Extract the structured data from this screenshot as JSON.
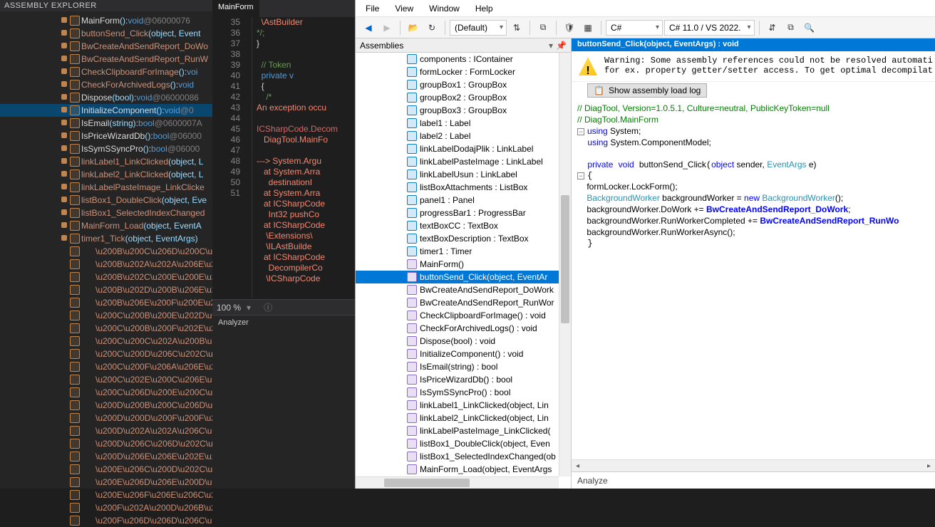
{
  "darkLeft": {
    "title": "Assembly Explorer",
    "items": [
      {
        "name": "MainForm",
        "params": "()",
        "type": "void",
        "addr": "@06000076",
        "sel": false,
        "orange": false
      },
      {
        "name": "buttonSend_Click",
        "params": "(object, Event",
        "type": "",
        "addr": "",
        "sel": false,
        "orange": true
      },
      {
        "name": "BwCreateAndSendReport_DoWo",
        "params": "",
        "type": "",
        "addr": "",
        "sel": false,
        "orange": true
      },
      {
        "name": "BwCreateAndSendReport_RunW",
        "params": "",
        "type": "",
        "addr": "",
        "sel": false,
        "orange": true
      },
      {
        "name": "CheckClipboardForImage",
        "params": "()",
        "type": "voi",
        "addr": "",
        "sel": false,
        "orange": true
      },
      {
        "name": "CheckForArchivedLogs",
        "params": "()",
        "type": "void",
        "addr": "",
        "sel": false,
        "orange": true
      },
      {
        "name": "Dispose",
        "params": "(bool)",
        "type": "void",
        "addr": "@06000086",
        "sel": false,
        "orange": false
      },
      {
        "name": "InitializeComponent",
        "params": "()",
        "type": "void",
        "addr": "@0",
        "sel": true,
        "orange": false
      },
      {
        "name": "IsEmail",
        "params": "(string)",
        "type": "bool",
        "addr": "@0600007A",
        "sel": false,
        "orange": false
      },
      {
        "name": "IsPriceWizardDb",
        "params": "()",
        "type": "bool",
        "addr": "@06000",
        "sel": false,
        "orange": false
      },
      {
        "name": "IsSymSSyncPro",
        "params": "()",
        "type": "bool",
        "addr": "@06000",
        "sel": false,
        "orange": false
      },
      {
        "name": "linkLabel1_LinkClicked",
        "params": "(object, L",
        "type": "",
        "addr": "",
        "sel": false,
        "orange": true
      },
      {
        "name": "linkLabel2_LinkClicked",
        "params": "(object, L",
        "type": "",
        "addr": "",
        "sel": false,
        "orange": true
      },
      {
        "name": "linkLabelPasteImage_LinkClicke",
        "params": "",
        "type": "",
        "addr": "",
        "sel": false,
        "orange": true
      },
      {
        "name": "listBox1_DoubleClick",
        "params": "(object, Eve",
        "type": "",
        "addr": "",
        "sel": false,
        "orange": true
      },
      {
        "name": "listBox1_SelectedIndexChanged",
        "params": "",
        "type": "",
        "addr": "",
        "sel": false,
        "orange": true
      },
      {
        "name": "MainForm_Load",
        "params": "(object, EventA",
        "type": "",
        "addr": "",
        "sel": false,
        "orange": true
      },
      {
        "name": "timer1_Tick",
        "params": "(object, EventArgs)",
        "type": "",
        "addr": "",
        "sel": false,
        "orange": true
      }
    ],
    "unicodeItems": [
      "\\u200B\\u200C\\u206D\\u200C\\u206E",
      "\\u200B\\u202A\\u202A\\u206E\\u2",
      "\\u200B\\u202C\\u200E\\u200E\\u20",
      "\\u200B\\u202D\\u200B\\u206E\\u2",
      "\\u200B\\u206E\\u200F\\u200E\\u20",
      "\\u200C\\u200B\\u200E\\u202D\\u2",
      "\\u200C\\u200B\\u200F\\u202E\\u2",
      "\\u200C\\u200C\\u202A\\u200B\\u2",
      "\\u200C\\u200D\\u206C\\u202C\\u2",
      "\\u200C\\u200F\\u206A\\u206E\\u2",
      "\\u200C\\u202E\\u200C\\u206E\\u2",
      "\\u200C\\u206D\\u200E\\u200C\\u2",
      "\\u200D\\u200B\\u200C\\u206D\\u2",
      "\\u200D\\u200D\\u200F\\u200F\\u2",
      "\\u200D\\u202A\\u202A\\u206C\\u2",
      "\\u200D\\u206C\\u206D\\u202C\\u2",
      "\\u200D\\u206E\\u206E\\u202E\\u2",
      "\\u200E\\u206C\\u200D\\u202C\\u2",
      "\\u200E\\u206D\\u206E\\u200D\\u2",
      "\\u200E\\u206F\\u206E\\u206C\\u2",
      "\\u200F\\u202A\\u200D\\u206B\\u2",
      "\\u200F\\u206D\\u206D\\u206C\\u2"
    ]
  },
  "darkMid": {
    "tab": "MainForm",
    "lines": [
      {
        "n": "",
        "t": "  \\AstBuilder",
        "cls": "er"
      },
      {
        "n": "35",
        "t": "*/;",
        "cls": "cm"
      },
      {
        "n": "36",
        "t": "}",
        "cls": ""
      },
      {
        "n": "37",
        "t": "",
        "cls": ""
      },
      {
        "n": "38",
        "t": "  // Token",
        "cls": "cm"
      },
      {
        "n": "39",
        "t": "  private v",
        "cls": "kw"
      },
      {
        "n": "40",
        "t": "  {",
        "cls": ""
      },
      {
        "n": "41",
        "t": "    /*",
        "cls": "cm"
      },
      {
        "n": "42",
        "t": "An exception occu",
        "cls": "er"
      },
      {
        "n": "43",
        "t": "",
        "cls": ""
      },
      {
        "n": "44",
        "t": "ICSharpCode.Decom",
        "cls": "er2"
      },
      {
        "n": "",
        "t": "   DiagTool.MainFo",
        "cls": "er"
      },
      {
        "n": "45",
        "t": "",
        "cls": ""
      },
      {
        "n": "46",
        "t": "---> System.Argu",
        "cls": "er"
      },
      {
        "n": "47",
        "t": "   at System.Arra",
        "cls": "er"
      },
      {
        "n": "",
        "t": "     destinationI",
        "cls": "er"
      },
      {
        "n": "48",
        "t": "   at System.Arra",
        "cls": "er"
      },
      {
        "n": "49",
        "t": "   at ICSharpCode",
        "cls": "er"
      },
      {
        "n": "",
        "t": "     Int32 pushCo",
        "cls": "er"
      },
      {
        "n": "50",
        "t": "   at ICSharpCode",
        "cls": "er"
      },
      {
        "n": "",
        "t": "    \\Extensions\\",
        "cls": "er"
      },
      {
        "n": "",
        "t": "    \\ILAstBuilde",
        "cls": "er"
      },
      {
        "n": "51",
        "t": "   at ICSharpCode",
        "cls": "er"
      },
      {
        "n": "",
        "t": "     DecompilerCo",
        "cls": "er"
      },
      {
        "n": "",
        "t": "    \\ICSharpCode",
        "cls": "er"
      }
    ],
    "zoom": "100 %",
    "analyzer": "Analyzer"
  },
  "menu": [
    "File",
    "View",
    "Window",
    "Help"
  ],
  "toolbar": {
    "default": "(Default)",
    "lang": "C#",
    "ver": "C# 11.0 / VS 2022."
  },
  "asmPanel": {
    "title": "Assemblies",
    "fields": [
      "components : IContainer",
      "formLocker : FormLocker",
      "groupBox1 : GroupBox",
      "groupBox2 : GroupBox",
      "groupBox3 : GroupBox",
      "label1 : Label",
      "label2 : Label",
      "linkLabelDodajPlik : LinkLabel",
      "linkLabelPasteImage : LinkLabel",
      "linkLabelUsun : LinkLabel",
      "listBoxAttachments : ListBox",
      "panel1 : Panel",
      "progressBar1 : ProgressBar",
      "textBoxCC : TextBox",
      "textBoxDescription : TextBox",
      "timer1 : Timer"
    ],
    "methods": [
      {
        "t": "MainForm()",
        "sel": false
      },
      {
        "t": "buttonSend_Click(object, EventAr",
        "sel": true
      },
      {
        "t": "BwCreateAndSendReport_DoWork",
        "sel": false
      },
      {
        "t": "BwCreateAndSendReport_RunWor",
        "sel": false
      },
      {
        "t": "CheckClipboardForImage() : void",
        "sel": false
      },
      {
        "t": "CheckForArchivedLogs() : void",
        "sel": false
      },
      {
        "t": "Dispose(bool) : void",
        "sel": false
      },
      {
        "t": "InitializeComponent() : void",
        "sel": false
      },
      {
        "t": "IsEmail(string) : bool",
        "sel": false
      },
      {
        "t": "IsPriceWizardDb() : bool",
        "sel": false
      },
      {
        "t": "IsSymSSyncPro() : bool",
        "sel": false
      },
      {
        "t": "linkLabel1_LinkClicked(object, Lin",
        "sel": false
      },
      {
        "t": "linkLabel2_LinkClicked(object, Lin",
        "sel": false
      },
      {
        "t": "linkLabelPasteImage_LinkClicked(",
        "sel": false
      },
      {
        "t": "listBox1_DoubleClick(object, Even",
        "sel": false
      },
      {
        "t": "listBox1_SelectedIndexChanged(ob",
        "sel": false
      },
      {
        "t": "MainForm_Load(object, EventArgs",
        "sel": false
      }
    ]
  },
  "codeTab": "buttonSend_Click(object, EventArgs) : void",
  "warning": "Warning: Some assembly references could not be resolved automati\nfor ex. property getter/setter access. To get optimal decompilat",
  "logBtn": "Show assembly load log",
  "source": {
    "l1": "// DiagTool, Version=1.0.5.1, Culture=neutral, PublicKeyToken=null",
    "l2": "// DiagTool.MainForm",
    "l3a": "using",
    "l3b": " System;",
    "l4a": "using",
    "l4b": " System.ComponentModel;",
    "l6a": "private",
    "l6b": "void",
    "l6c": "buttonSend_Click",
    "l6d": "object",
    "l6e": " sender, ",
    "l6f": "EventArgs",
    "l6g": " e)",
    "l8": "    formLocker.LockForm();",
    "l9a": "    ",
    "l9b": "BackgroundWorker",
    "l9c": " backgroundWorker = ",
    "l9d": "new",
    "l9e": " ",
    "l9f": "BackgroundWorker",
    "l9g": "();",
    "l10a": "    backgroundWorker.DoWork += ",
    "l10b": "BwCreateAndSendReport_DoWork",
    "l10c": ";",
    "l11a": "    backgroundWorker.RunWorkerCompleted += ",
    "l11b": "BwCreateAndSendReport_RunWo",
    "l11c": "",
    "l12": "    backgroundWorker.RunWorkerAsync();"
  },
  "analyze": "Analyze"
}
